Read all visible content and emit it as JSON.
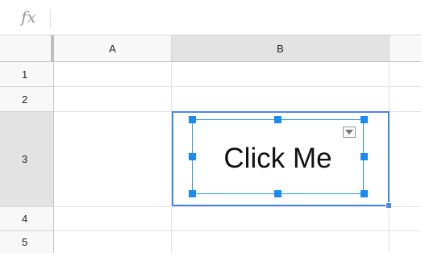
{
  "formula_bar": {
    "fx_label": "fx",
    "value": ""
  },
  "columns": [
    "A",
    "B"
  ],
  "rows": [
    "1",
    "2",
    "3",
    "4",
    "5"
  ],
  "selection": {
    "cell": "B3",
    "accent_color": "#4a86e8"
  },
  "drawing": {
    "text": "Click Me",
    "icon": "dropdown-arrow-icon"
  },
  "colors": {
    "header_bg": "#f8f8f8",
    "selected_header_bg": "#e3e3e3",
    "handle": "#1a8cf0"
  }
}
